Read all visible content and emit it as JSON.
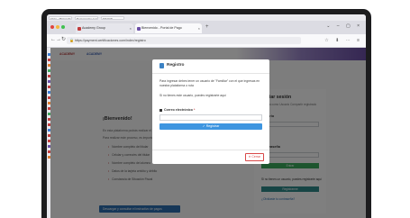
{
  "taskbar": {
    "tabs": [
      "Inicio - Microsoft Edge",
      "Documentos compartidos",
      "FICHAS"
    ]
  },
  "browser": {
    "tabs": [
      {
        "label": "Academy Group"
      },
      {
        "label": "Bienvenido - Portal de Pago"
      }
    ],
    "url": "https://payment.certificaciones.com/index/registro",
    "colors": {
      "accent": "#6b4fa6",
      "close": "#e0443e",
      "min": "#f5b83d",
      "max": "#3fc04f"
    }
  },
  "page": {
    "logo_left": "ACADEMY",
    "logo_right": "ACADEMY",
    "welcome_title": "¡Bienvenido!",
    "intro_lines": [
      "En esta plataforma podrás realizar el pago",
      "Para realizar este proceso, es importante qu"
    ],
    "bullets": [
      "Nombre completo del titular",
      "Celular y correo/es del titular",
      "Nombre completo del alumno",
      "Datos de la tarjeta crédito y débito",
      "Constancia de Situación Fiscal"
    ],
    "download_button": "Descargar y consultar el instructivo de pagos",
    "login": {
      "title": "Iniciar sesión",
      "subtitle": "Ingresa como Usuario Compartir registrado",
      "user_label": "Usuario",
      "password_label": "Contraseña",
      "enter_button": "Entrar",
      "no_user_text": "Si no tienes un usuario, puedes registrarte aquí",
      "register_button": "Registrarme",
      "forgot_link": "¿Olvidaste tu contraseña?"
    }
  },
  "modal": {
    "title": "Registro",
    "paragraph1": "Para ingresar debes tener un usuario de \"Familiar\" con el que ingresas en nuestra plataforma o ruta",
    "paragraph2": "Si no tienes este usuario, puedes registrarte aquí",
    "email_label": "Correo electrónico",
    "required_mark": "*",
    "email_value": "",
    "submit_label": "✓ Registrar",
    "close_label": "✕ Cerrar"
  }
}
